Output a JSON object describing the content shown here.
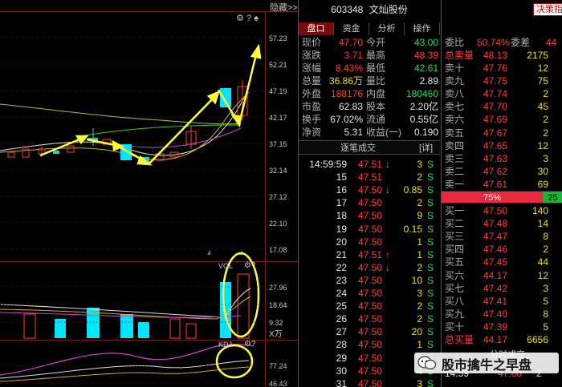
{
  "chart_controls": {
    "hide_label": "隐藏",
    "collapse": ">>",
    "gear": "⚙",
    "help": "?",
    "pin": "♠"
  },
  "kline": {
    "price_ticks": [
      "57.23",
      "52.21",
      "47.19",
      "42.17",
      "37.15",
      "32.14",
      "27.12",
      "22.10",
      "17.08"
    ],
    "price_range": [
      17.08,
      57.23
    ]
  },
  "vol": {
    "label": "VOL",
    "ticks": [
      "27.96",
      "18.64",
      "9.32"
    ],
    "unit": "X万"
  },
  "kdj": {
    "label": "KDJ",
    "ticks": [
      "77.24",
      "46.43"
    ]
  },
  "header": {
    "code": "603348",
    "name": "文灿股份",
    "decide_label": "决策指"
  },
  "tabs": [
    "盘口",
    "资金",
    "分析",
    "操作"
  ],
  "quote": [
    {
      "l1": "现价",
      "v1": "47.70",
      "l2": "今开",
      "v2": "43.00",
      "c1": "red",
      "c2": "grn"
    },
    {
      "l1": "涨跌",
      "v1": "3.71",
      "l2": "最高",
      "v2": "48.39",
      "c1": "red",
      "c2": "red"
    },
    {
      "l1": "涨幅",
      "v1": "8.43%",
      "l2": "最低",
      "v2": "42.61",
      "c1": "red",
      "c2": "grn"
    },
    {
      "l1": "总量",
      "v1": "36.86万",
      "l2": "量比",
      "v2": "2.89",
      "c1": "yel",
      "c2": "wht"
    },
    {
      "l1": "外盘",
      "v1": "188176",
      "l2": "内盘",
      "v2": "180460",
      "c1": "red",
      "c2": "grn"
    },
    {
      "l1": "市盈",
      "v1": "62.83",
      "l2": "股本",
      "v2": "2.20亿",
      "c1": "wht",
      "c2": "wht"
    },
    {
      "l1": "换手",
      "v1": "67.02%",
      "l2": "流通",
      "v2": "0.55亿",
      "c1": "wht",
      "c2": "wht"
    },
    {
      "l1": "净资",
      "v1": "5.31",
      "l2": "收益(一)",
      "v2": "0.190",
      "c1": "wht",
      "c2": "wht"
    }
  ],
  "ticks_section": {
    "title": "逐笔成交",
    "detail": "[详]"
  },
  "trades": [
    {
      "t": "14:59:59",
      "p": "47.51",
      "d": "↓",
      "v": "3",
      "s": "S",
      "pc": "red",
      "dc": "grn"
    },
    {
      "t": "15",
      "p": "47.51",
      "d": "",
      "v": "2",
      "s": "S",
      "pc": "red",
      "dc": ""
    },
    {
      "t": "16",
      "p": "47.50",
      "d": "↓",
      "v": "0.85",
      "s": "S",
      "pc": "red",
      "dc": "grn"
    },
    {
      "t": "17",
      "p": "47.50",
      "d": "",
      "v": "2",
      "s": "S",
      "pc": "red",
      "dc": ""
    },
    {
      "t": "18",
      "p": "47.50",
      "d": "",
      "v": "9",
      "s": "S",
      "pc": "red",
      "dc": ""
    },
    {
      "t": "19",
      "p": "47.50",
      "d": "",
      "v": "0.15",
      "s": "S",
      "pc": "red",
      "dc": ""
    },
    {
      "t": "20",
      "p": "47.50",
      "d": "",
      "v": "1",
      "s": "S",
      "pc": "red",
      "dc": ""
    },
    {
      "t": "21",
      "p": "47.51",
      "d": "↑",
      "v": "1",
      "s": "S",
      "pc": "red",
      "dc": "red"
    },
    {
      "t": "22",
      "p": "47.50",
      "d": "↓",
      "v": "2",
      "s": "S",
      "pc": "red",
      "dc": "grn"
    },
    {
      "t": "23",
      "p": "47.50",
      "d": "",
      "v": "10",
      "s": "S",
      "pc": "red",
      "dc": ""
    },
    {
      "t": "24",
      "p": "47.50",
      "d": "",
      "v": "3",
      "s": "S",
      "pc": "red",
      "dc": ""
    },
    {
      "t": "25",
      "p": "47.50",
      "d": "",
      "v": "2",
      "s": "S",
      "pc": "red",
      "dc": ""
    },
    {
      "t": "26",
      "p": "47.50",
      "d": "",
      "v": "2",
      "s": "S",
      "pc": "red",
      "dc": ""
    },
    {
      "t": "27",
      "p": "47.50",
      "d": "",
      "v": "20",
      "s": "S",
      "pc": "red",
      "dc": ""
    },
    {
      "t": "28",
      "p": "47.50",
      "d": "",
      "v": "1",
      "s": "S",
      "pc": "red",
      "dc": ""
    },
    {
      "t": "29",
      "p": "47.50",
      "d": "",
      "v": "3",
      "s": "S",
      "pc": "red",
      "dc": ""
    },
    {
      "t": "30",
      "p": "47.50",
      "d": "",
      "v": "4",
      "s": "S",
      "pc": "red",
      "dc": ""
    },
    {
      "t": "31",
      "p": "47.50",
      "d": "",
      "v": "3",
      "s": "S",
      "pc": "red",
      "dc": ""
    }
  ],
  "book": {
    "weibi_label": "委比",
    "weibi": "50.74%",
    "weicha_label": "委差",
    "weicha": "44",
    "total_sell_label": "总卖量",
    "total_sell_price": "48.13",
    "total_sell_vol": "2175",
    "sells": [
      {
        "l": "卖十",
        "p": "47.76",
        "v": "12"
      },
      {
        "l": "卖九",
        "p": "47.75",
        "v": "75"
      },
      {
        "l": "卖八",
        "p": "47.74",
        "v": "2"
      },
      {
        "l": "卖七",
        "p": "47.70",
        "v": "45"
      },
      {
        "l": "卖六",
        "p": "47.69",
        "v": "2"
      },
      {
        "l": "卖五",
        "p": "47.67",
        "v": "2"
      },
      {
        "l": "卖四",
        "p": "47.65",
        "v": "12"
      },
      {
        "l": "卖三",
        "p": "47.63",
        "v": "3"
      },
      {
        "l": "卖二",
        "p": "47.62",
        "v": "30"
      },
      {
        "l": "卖一",
        "p": "47.61",
        "v": "69"
      }
    ],
    "bar_left": "75%",
    "bar_right": "25",
    "buys": [
      {
        "l": "买一",
        "p": "47.50",
        "v": "140"
      },
      {
        "l": "买二",
        "p": "47.48",
        "v": "14"
      },
      {
        "l": "买三",
        "p": "47.47",
        "v": "8"
      },
      {
        "l": "买四",
        "p": "47.46",
        "v": "2"
      },
      {
        "l": "买五",
        "p": "47.45",
        "v": "44"
      },
      {
        "l": "买六",
        "p": "44.17",
        "v": "12"
      },
      {
        "l": "买七",
        "p": "47.42",
        "v": "3"
      },
      {
        "l": "买八",
        "p": "47.41",
        "v": "5"
      },
      {
        "l": "买九",
        "p": "47.40",
        "v": "8"
      },
      {
        "l": "买十",
        "p": "47.39",
        "v": "5"
      }
    ],
    "total_buy_label": "总买量",
    "total_buy_price": "44.17",
    "total_buy_vol": "6656"
  },
  "bottom": {
    "section_label": "分时成交",
    "time": "14:59",
    "price": "47.80",
    "vol": "2"
  },
  "watermark": {
    "text": "股市擒牛之早盘"
  },
  "colors": {
    "up": "#ff3c3c",
    "down": "#2cd65a",
    "cyan": "#2ecbcb",
    "yellow": "#f0e000",
    "annotation": "#ffff33",
    "panel_border": "#7a1a1a"
  }
}
